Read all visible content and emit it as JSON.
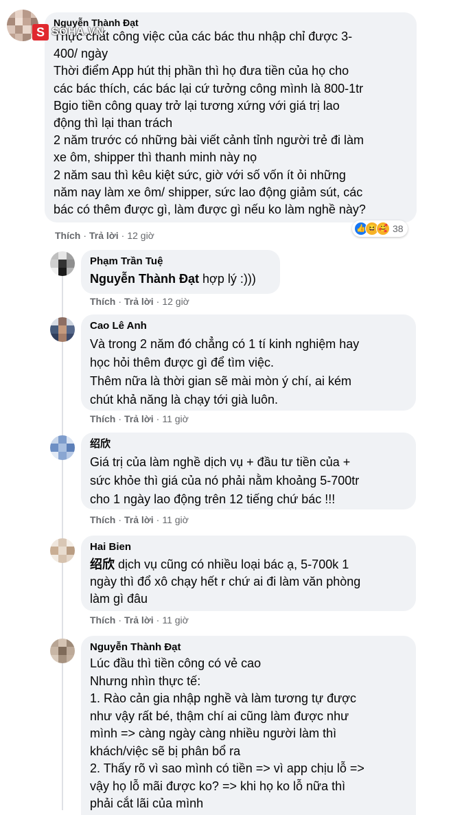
{
  "watermark": {
    "badge": "S",
    "text": "SOHA.VN"
  },
  "comments": [
    {
      "author": "Nguyễn Thành Đạt",
      "text": "Thực chất công việc của các bác thu nhập chỉ được 3-\n400/ ngày\nThời điểm App hút thị phần thì họ đưa tiền của họ cho\ncác bác thích, các bác lại cứ tưởng công mình là 800-1tr\nBgio tiền công quay trở lại tương xứng với giá trị lao\nđộng thì lại than trách\n2 năm trước có những bài viết cảnh tỉnh người trẻ đi làm\nxe ôm, shipper thì thanh minh này nọ\n2 năm sau thì kêu kiệt sức, giờ với số vốn ít ỏi những\nnăm nay làm xe ôm/ shipper, sức lao động giảm sút, các\nbác có thêm được gì, làm được gì nếu ko làm nghề này?",
      "like": "Thích",
      "reply": "Trả lời",
      "time": "12 giờ",
      "reactions": {
        "count": "38",
        "icons": [
          "like-icon",
          "haha-icon",
          "care-icon"
        ]
      }
    },
    {
      "author": "Phạm Trần Tuệ",
      "mention": "Nguyễn Thành Đạt",
      "text": " hợp lý :)))",
      "like": "Thích",
      "reply": "Trả lời",
      "time": "12 giờ"
    },
    {
      "author": "Cao Lê Anh",
      "text": "Và trong 2 năm đó chẳng có 1 tí kinh nghiệm hay\nhọc hỏi thêm được gì để tìm việc.\nThêm nữa là thời gian sẽ mài mòn ý chí, ai kém\nchút khả năng là chạy tới già luôn.",
      "like": "Thích",
      "reply": "Trả lời",
      "time": "11 giờ"
    },
    {
      "author": "绍欣",
      "text": "Giá trị của làm nghề dịch vụ + đầu tư tiền của +\nsức khỏe thì giá của nó phải nằm khoảng 5-700tr\ncho 1 ngày lao động trên 12 tiếng chứ bác !!!",
      "like": "Thích",
      "reply": "Trả lời",
      "time": "11 giờ"
    },
    {
      "author": "Hai Bien",
      "mention": "绍欣",
      "text": " dịch vụ cũng có nhiều loại bác ạ, 5-700k 1\nngày thì đổ xô chạy hết r chứ ai đi làm văn phòng\nlàm gì đâu",
      "like": "Thích",
      "reply": "Trả lời",
      "time": "11 giờ"
    },
    {
      "author": "Nguyễn Thành Đạt",
      "text": "Lúc đầu thì tiền công có vẻ cao\nNhưng nhìn thực tế:\n1. Rào cản gia nhập nghề và làm tương tự được\nnhư vậy rất bé, thậm chí ai cũng làm được như\nmình => càng ngày càng nhiều người làm thì\nkhách/việc sẽ bị phân bổ ra\n2. Thấy rõ vì sao mình có tiền => vì app chịu lỗ =>\nvậy họ lỗ mãi được ko? => khi họ ko lỗ nữa thì\nphải cắt lãi của mình"
    }
  ]
}
